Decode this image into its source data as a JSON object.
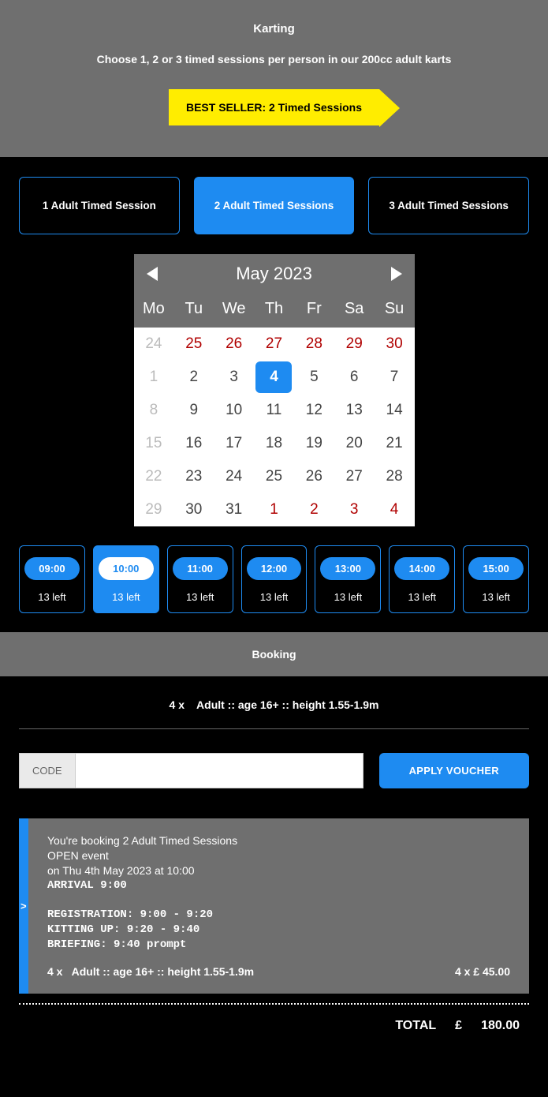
{
  "header": {
    "title": "Karting",
    "subtitle": "Choose 1, 2 or 3 timed sessions per person in our 200cc adult karts",
    "best_seller": "BEST SELLER: 2 Timed Sessions"
  },
  "sessions": [
    {
      "label": "1 Adult Timed Session",
      "active": false
    },
    {
      "label": "2 Adult Timed Sessions",
      "active": true
    },
    {
      "label": "3 Adult Timed Sessions",
      "active": false
    }
  ],
  "calendar": {
    "month": "May 2023",
    "days": [
      "Mo",
      "Tu",
      "We",
      "Th",
      "Fr",
      "Sa",
      "Su"
    ],
    "rows": [
      [
        {
          "n": "24",
          "cls": "disabled"
        },
        {
          "n": "25",
          "cls": "red"
        },
        {
          "n": "26",
          "cls": "red"
        },
        {
          "n": "27",
          "cls": "red"
        },
        {
          "n": "28",
          "cls": "red"
        },
        {
          "n": "29",
          "cls": "red"
        },
        {
          "n": "30",
          "cls": "red"
        }
      ],
      [
        {
          "n": "1",
          "cls": "disabled"
        },
        {
          "n": "2",
          "cls": ""
        },
        {
          "n": "3",
          "cls": ""
        },
        {
          "n": "4",
          "cls": "selected"
        },
        {
          "n": "5",
          "cls": ""
        },
        {
          "n": "6",
          "cls": ""
        },
        {
          "n": "7",
          "cls": ""
        }
      ],
      [
        {
          "n": "8",
          "cls": "disabled"
        },
        {
          "n": "9",
          "cls": ""
        },
        {
          "n": "10",
          "cls": ""
        },
        {
          "n": "11",
          "cls": ""
        },
        {
          "n": "12",
          "cls": ""
        },
        {
          "n": "13",
          "cls": ""
        },
        {
          "n": "14",
          "cls": ""
        }
      ],
      [
        {
          "n": "15",
          "cls": "disabled"
        },
        {
          "n": "16",
          "cls": ""
        },
        {
          "n": "17",
          "cls": ""
        },
        {
          "n": "18",
          "cls": ""
        },
        {
          "n": "19",
          "cls": ""
        },
        {
          "n": "20",
          "cls": ""
        },
        {
          "n": "21",
          "cls": ""
        }
      ],
      [
        {
          "n": "22",
          "cls": "disabled"
        },
        {
          "n": "23",
          "cls": ""
        },
        {
          "n": "24",
          "cls": ""
        },
        {
          "n": "25",
          "cls": ""
        },
        {
          "n": "26",
          "cls": ""
        },
        {
          "n": "27",
          "cls": ""
        },
        {
          "n": "28",
          "cls": ""
        }
      ],
      [
        {
          "n": "29",
          "cls": "disabled"
        },
        {
          "n": "30",
          "cls": ""
        },
        {
          "n": "31",
          "cls": ""
        },
        {
          "n": "1",
          "cls": "red"
        },
        {
          "n": "2",
          "cls": "red"
        },
        {
          "n": "3",
          "cls": "red"
        },
        {
          "n": "4",
          "cls": "red"
        }
      ]
    ]
  },
  "times": [
    {
      "time": "09:00",
      "left": "13 left",
      "active": false
    },
    {
      "time": "10:00",
      "left": "13 left",
      "active": true
    },
    {
      "time": "11:00",
      "left": "13 left",
      "active": false
    },
    {
      "time": "12:00",
      "left": "13 left",
      "active": false
    },
    {
      "time": "13:00",
      "left": "13 left",
      "active": false
    },
    {
      "time": "14:00",
      "left": "13 left",
      "active": false
    },
    {
      "time": "15:00",
      "left": "13 left",
      "active": false
    }
  ],
  "booking": {
    "heading": "Booking",
    "summary_qty": "4 x",
    "summary_desc": "Adult :: age 16+ :: height 1.55-1.9m",
    "code_label": "CODE",
    "apply_label": "APPLY VOUCHER"
  },
  "details": {
    "caret": ">",
    "l1": "You're booking 2 Adult Timed Sessions",
    "l2": "OPEN event",
    "l3": "on Thu 4th May 2023 at 10:00",
    "arrival_label": "ARRIVAL",
    "arrival_time": "9:00",
    "reg_label": "REGISTRATION:",
    "reg_time": "9:00 - 9:20",
    "kit_label": "KITTING UP:",
    "kit_time": "9:20 - 9:40",
    "brief_label": "BRIEFING:",
    "brief_time": "9:40 prompt",
    "bottom_left_qty": "4 x",
    "bottom_left_desc": "Adult :: age 16+ :: height 1.55-1.9m",
    "bottom_right": "4 x £ 45.00"
  },
  "total": {
    "label": "TOTAL",
    "currency": "£",
    "amount": "180.00"
  }
}
